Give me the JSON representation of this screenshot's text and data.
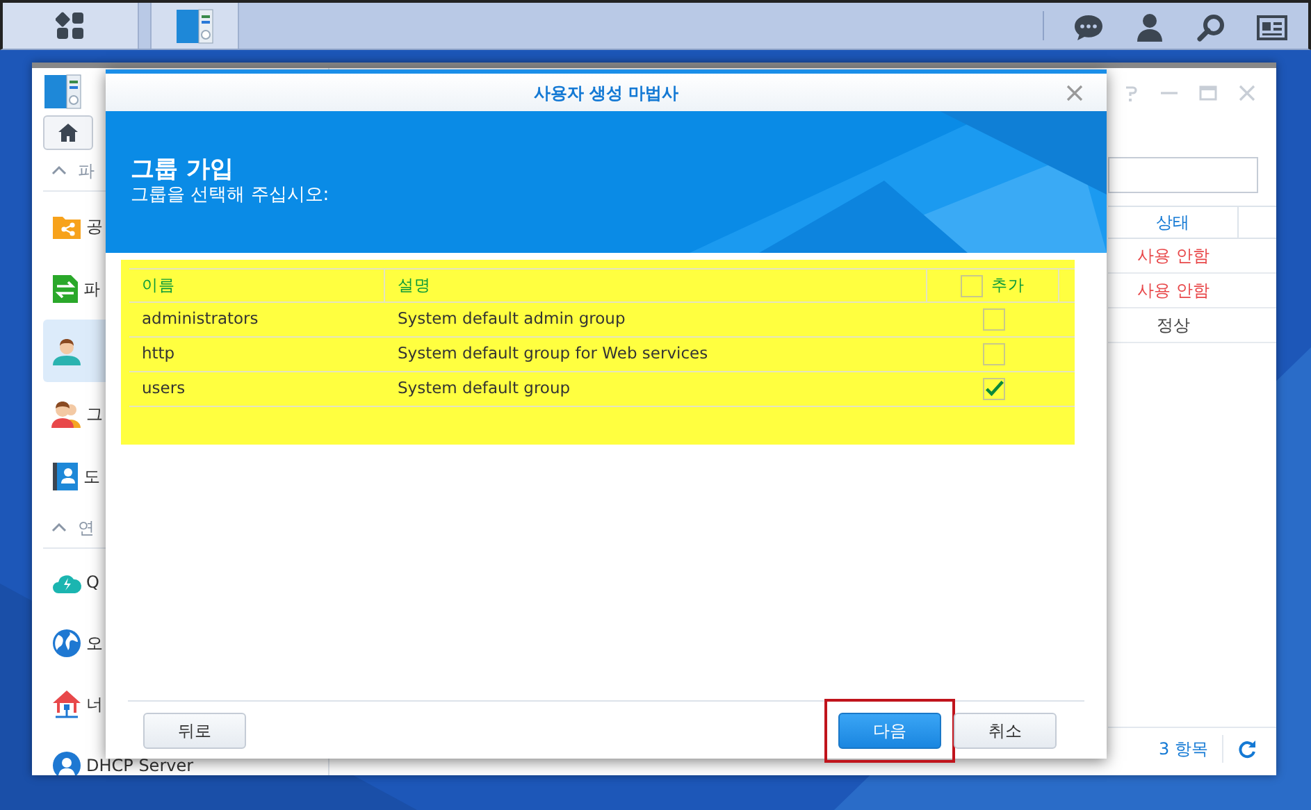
{
  "taskbar": {
    "buttons": [
      {
        "kind": "main-menu",
        "selected": false
      },
      {
        "kind": "app",
        "selected": true
      }
    ],
    "tray": [
      {
        "kind": "chat"
      },
      {
        "kind": "user"
      },
      {
        "kind": "search"
      },
      {
        "kind": "widgets"
      }
    ]
  },
  "background_window": {
    "sidebar": {
      "sections": [
        {
          "header": "파",
          "items": [
            {
              "label": "공",
              "selected": false
            },
            {
              "label": "파",
              "selected": false
            },
            {
              "selected": true
            },
            {
              "label": "그",
              "selected": false
            },
            {
              "label": "도",
              "selected": false
            }
          ]
        },
        {
          "header": "연",
          "items": [
            {
              "label": "Q",
              "selected": false
            },
            {
              "label": "오",
              "selected": false
            },
            {
              "label": "너",
              "selected": false
            },
            {
              "label": "DHCP Server",
              "selected": false
            }
          ]
        }
      ]
    },
    "table": {
      "columns": [
        "상태"
      ],
      "rows": [
        {
          "status": "사용 안함",
          "kind": "disabled"
        },
        {
          "status": "사용 안함",
          "kind": "disabled"
        },
        {
          "status": "정상",
          "kind": "normal"
        }
      ]
    },
    "footer": {
      "count": "3 항목"
    }
  },
  "dialog": {
    "title": "사용자 생성 마법사",
    "heading": "그룹 가입",
    "subtitle": "그룹을 선택해 주십시오:",
    "table": {
      "highlighted": true,
      "columns": [
        "이름",
        "설명"
      ],
      "check_column": {
        "label": "추가",
        "checked": false
      },
      "rows": [
        {
          "name": "administrators",
          "description": "System default admin group",
          "checked": false
        },
        {
          "name": "http",
          "description": "System default group for Web services",
          "checked": false
        },
        {
          "name": "users",
          "description": "System default group",
          "checked": true
        }
      ]
    },
    "buttons": [
      {
        "label": "뒤로",
        "kind": "back"
      },
      {
        "label": "다음",
        "kind": "primary",
        "highlighted": true
      },
      {
        "label": "취소",
        "kind": "cancel"
      }
    ]
  }
}
